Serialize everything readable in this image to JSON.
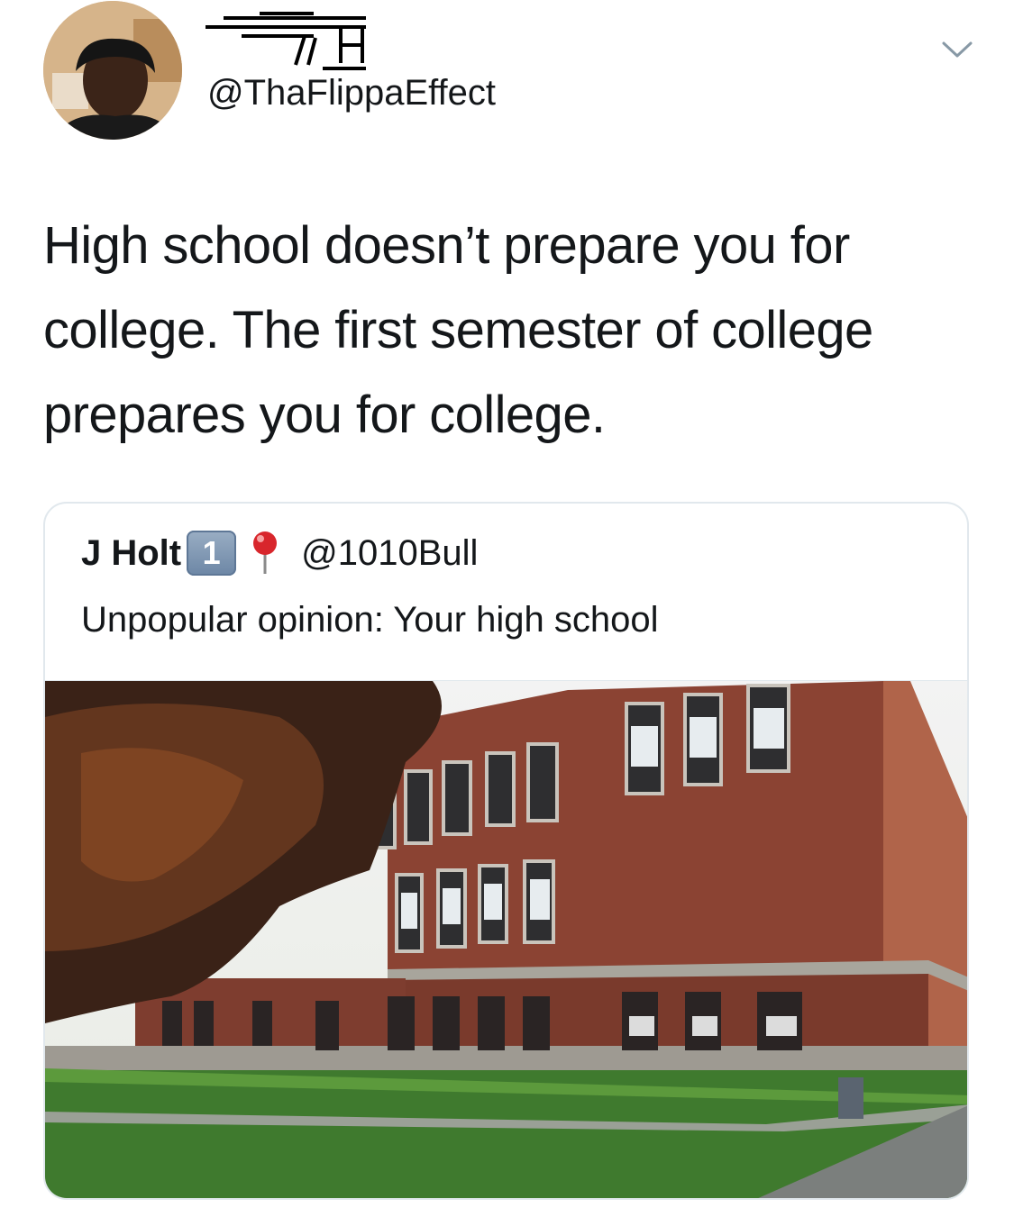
{
  "tweet": {
    "handle": "@ThaFlippaEffect",
    "text": "High school doesn’t prepare you for college. The first semester of college prepares you for college."
  },
  "quoted_tweet": {
    "name": "J Holt",
    "badge": "1",
    "handle": "@1010Bull",
    "text": "Unpopular opinion: Your high school"
  },
  "icons": {
    "menu": "chevron-down-icon",
    "pin": "round-pushpin-icon",
    "badge": "keycap-one-icon"
  }
}
